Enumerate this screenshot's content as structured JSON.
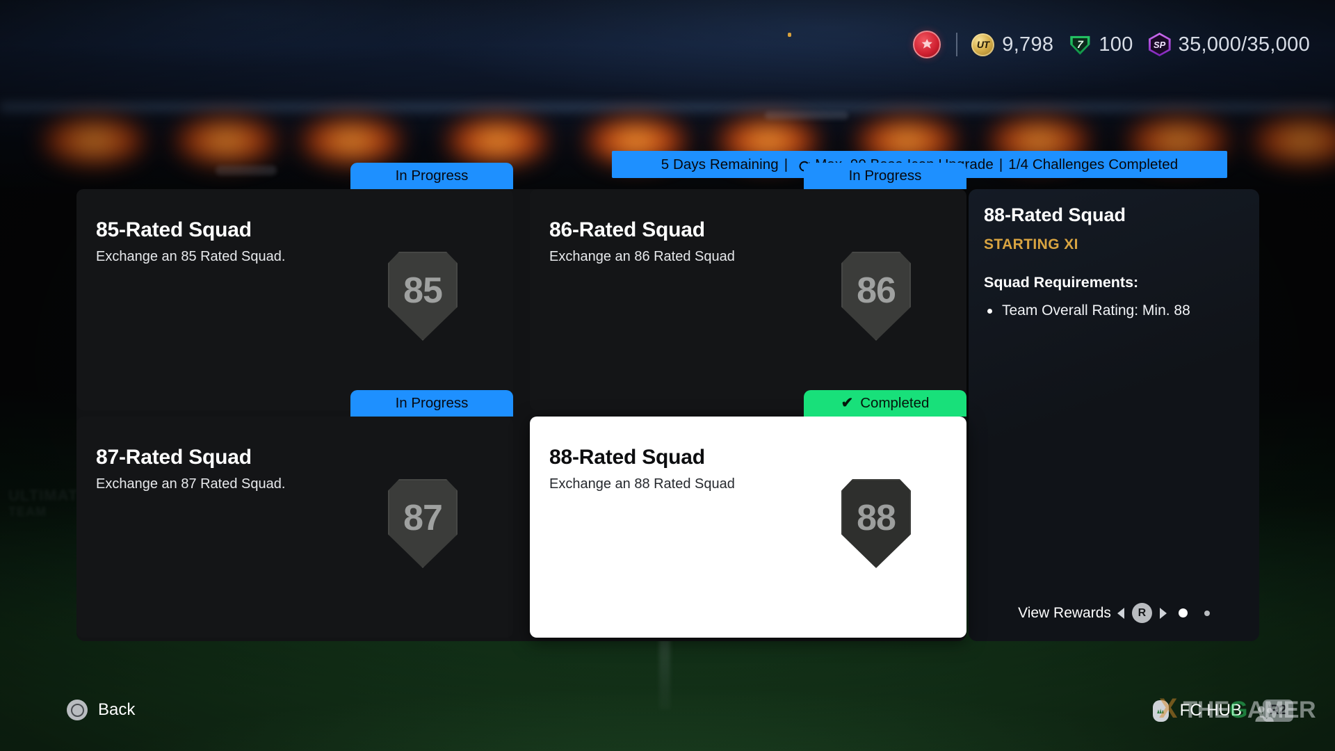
{
  "hud": {
    "club_badge_icon": "club-crest-icon",
    "currencies": [
      {
        "icon": "ut-coin-icon",
        "icon_label": "UT",
        "value": "9,798"
      },
      {
        "icon": "fc-points-icon",
        "icon_label": "7",
        "value": "100"
      },
      {
        "icon": "season-points-icon",
        "icon_label": "SP",
        "value": "35,000/35,000"
      }
    ]
  },
  "banner": {
    "days_remaining": "5 Days Remaining",
    "divider_1": "|",
    "refresh_icon": "refresh-icon",
    "title": "Max. 90 Base Icon Upgrade",
    "divider_2": "|",
    "progress": "1/4 Challenges Completed"
  },
  "challenges": [
    {
      "title": "85-Rated Squad",
      "description": "Exchange an 85 Rated Squad.",
      "rating": "85",
      "status": "In Progress",
      "status_type": "progress",
      "selected": false
    },
    {
      "title": "86-Rated Squad",
      "description": "Exchange an 86 Rated Squad",
      "rating": "86",
      "status": "In Progress",
      "status_type": "progress",
      "selected": false
    },
    {
      "title": "87-Rated Squad",
      "description": "Exchange an 87 Rated Squad.",
      "rating": "87",
      "status": "In Progress",
      "status_type": "progress",
      "selected": false
    },
    {
      "title": "88-Rated Squad",
      "description": "Exchange an 88 Rated Squad",
      "rating": "88",
      "status": "Completed",
      "status_check": "✔",
      "status_type": "completed",
      "selected": true
    }
  ],
  "detail": {
    "title": "88-Rated Squad",
    "subtitle": "STARTING XI",
    "requirements_heading": "Squad Requirements:",
    "requirements": [
      "Team Overall Rating: Min. 88"
    ],
    "rewards_label": "View Rewards",
    "rewards_button": "R",
    "page_indicator": "1 of 2"
  },
  "footer": {
    "back_label": "Back",
    "back_icon": "circle-button-icon",
    "hub_label": "FC HUB",
    "hub_icon": "touchpad-icon",
    "r2_label": "R2"
  },
  "watermark": {
    "x": "X",
    "text_a": "THE",
    "text_b": "G",
    "text_c": "AMER"
  },
  "colors": {
    "accent_blue": "#1e90ff",
    "accent_green": "#18e07a",
    "gold": "#d9a441",
    "panel": "#121315",
    "tile": "#1a1b1d",
    "selected": "#ffffff"
  }
}
